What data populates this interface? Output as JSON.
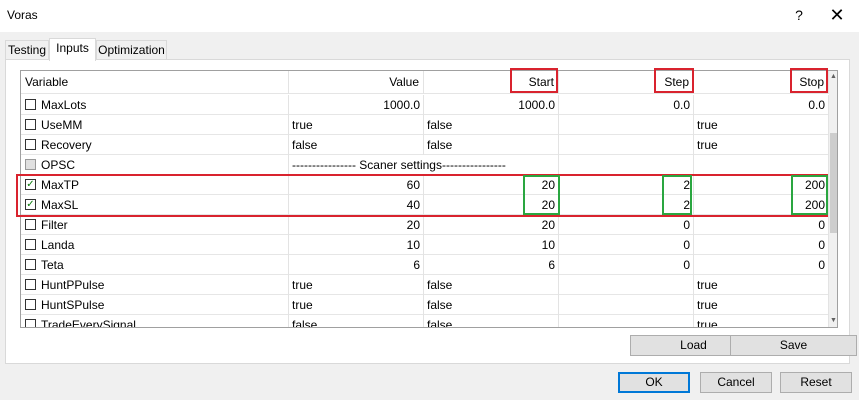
{
  "window": {
    "title": "Voras",
    "help_label": "?",
    "close_label": "✕"
  },
  "tabs": [
    {
      "label": "Testing",
      "active": false
    },
    {
      "label": "Inputs",
      "active": true
    },
    {
      "label": "Optimization",
      "active": false
    }
  ],
  "columns": {
    "variable": "Variable",
    "value": "Value",
    "start": "Start",
    "step": "Step",
    "stop": "Stop"
  },
  "rows": [
    {
      "checked": false,
      "name": "MaxLots",
      "value": "1000.0",
      "start": "1000.0",
      "step": "0.0",
      "stop": "0.0",
      "numeric": true
    },
    {
      "checked": false,
      "name": "UseMM",
      "value": "true",
      "start": "false",
      "step": "",
      "stop": "true",
      "numeric": false
    },
    {
      "checked": false,
      "name": "Recovery",
      "value": "false",
      "start": "false",
      "step": "",
      "stop": "true",
      "numeric": false
    },
    {
      "checked": false,
      "disabled": true,
      "name": "OPSC",
      "value": "---------------- Scaner settings----------------",
      "start": "",
      "step": "",
      "stop": "",
      "numeric": false
    },
    {
      "checked": true,
      "name": "MaxTP",
      "value": "60",
      "start": "20",
      "step": "2",
      "stop": "200",
      "numeric": true
    },
    {
      "checked": true,
      "name": "MaxSL",
      "value": "40",
      "start": "20",
      "step": "2",
      "stop": "200",
      "numeric": true
    },
    {
      "checked": false,
      "name": "Filter",
      "value": "20",
      "start": "20",
      "step": "0",
      "stop": "0",
      "numeric": true
    },
    {
      "checked": false,
      "name": "Landa",
      "value": "10",
      "start": "10",
      "step": "0",
      "stop": "0",
      "numeric": true
    },
    {
      "checked": false,
      "name": "Teta",
      "value": "6",
      "start": "6",
      "step": "0",
      "stop": "0",
      "numeric": true
    },
    {
      "checked": false,
      "name": "HuntPPulse",
      "value": "true",
      "start": "false",
      "step": "",
      "stop": "true",
      "numeric": false
    },
    {
      "checked": false,
      "name": "HuntSPulse",
      "value": "true",
      "start": "false",
      "step": "",
      "stop": "true",
      "numeric": false
    },
    {
      "checked": false,
      "name": "TradeEverySignal",
      "value": "false",
      "start": "false",
      "step": "",
      "stop": "true",
      "numeric": false
    }
  ],
  "buttons": {
    "load": "Load",
    "save": "Save",
    "ok": "OK",
    "cancel": "Cancel",
    "reset": "Reset"
  },
  "colors": {
    "highlight_red": "#d9232e",
    "highlight_green": "#2aa640",
    "default_button_border": "#0078d7"
  }
}
